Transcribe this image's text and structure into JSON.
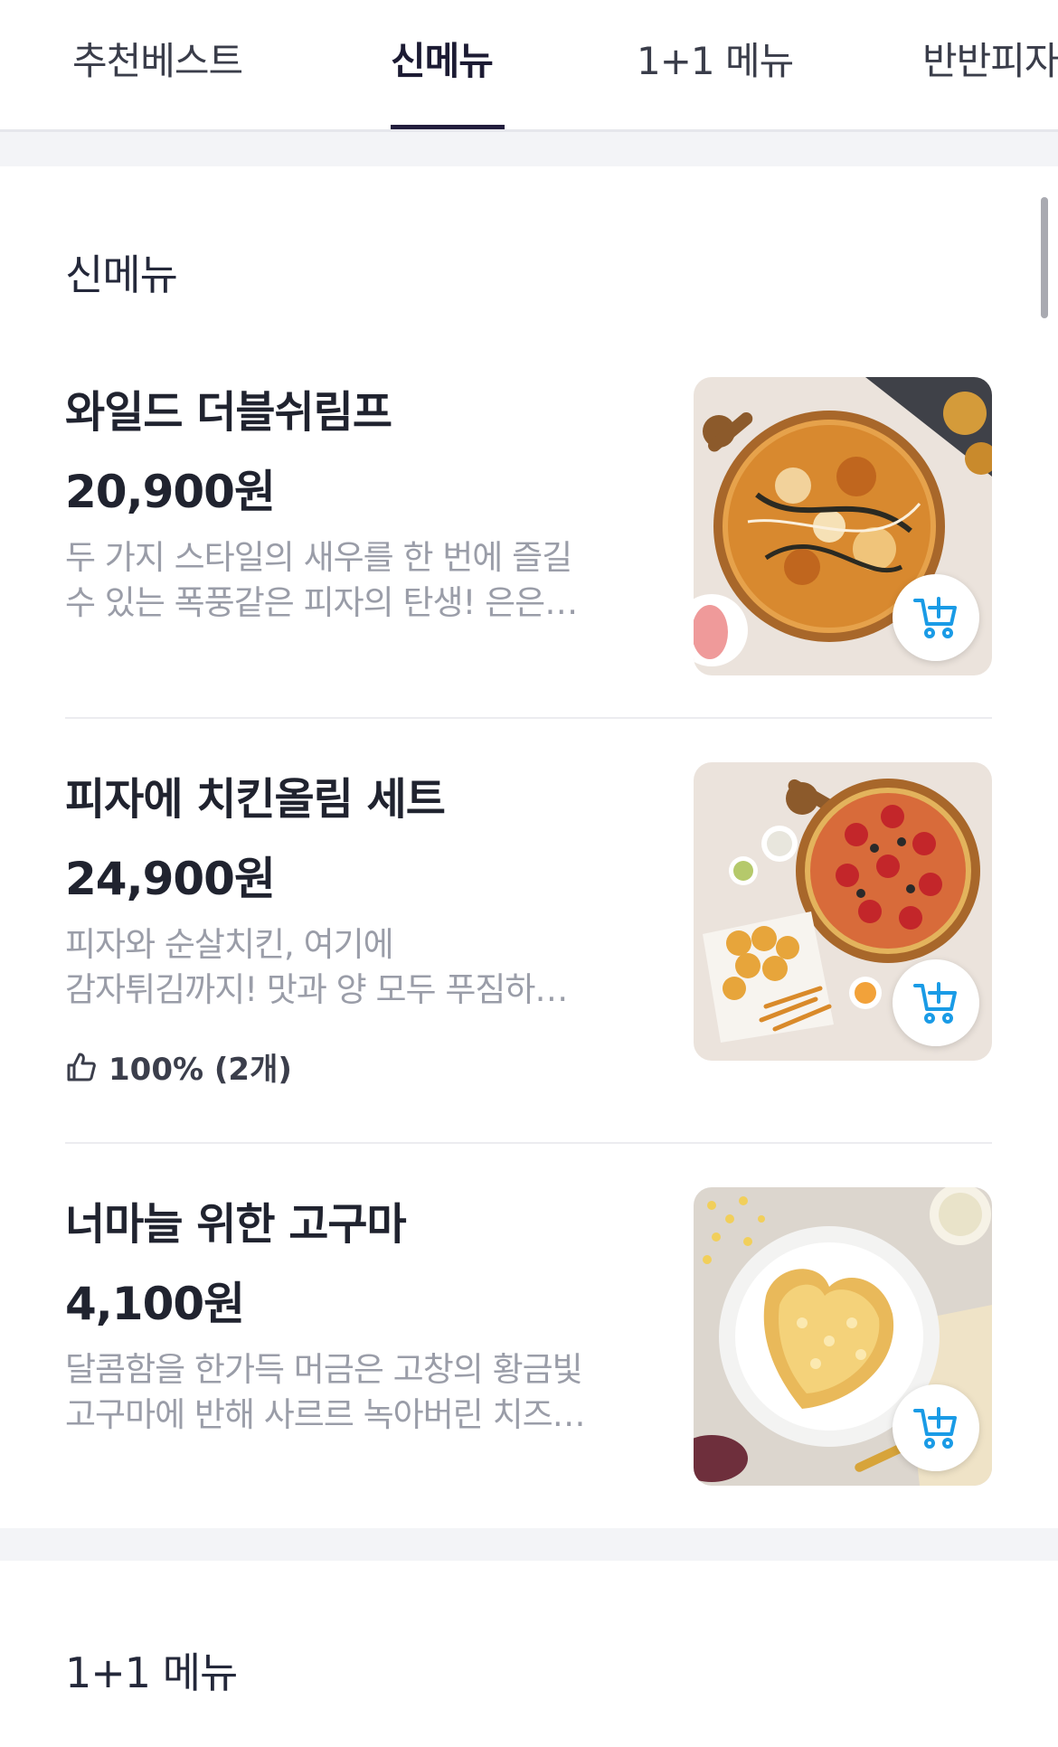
{
  "tabs": [
    {
      "label": "추천베스트",
      "active": false
    },
    {
      "label": "신메뉴",
      "active": true
    },
    {
      "label": "1+1 메뉴",
      "active": false
    },
    {
      "label": "반반피자",
      "active": false
    }
  ],
  "sections": [
    {
      "title": "신메뉴",
      "items": [
        {
          "name": "와일드 더블쉬림프",
          "price": "20,900원",
          "desc_line1": "두 가지 스타일의 새우를 한 번에 즐길",
          "desc_line2": "수 있는 폭풍같은 피자의 탄생! 은은…",
          "image": "pizza-shrimp-photo"
        },
        {
          "name": "피자에 치킨올림 세트",
          "price": "24,900원",
          "desc_line1": "피자와 순살치킨, 여기에",
          "desc_line2": "감자튀김까지! 맛과 양 모두 푸짐하…",
          "rating": "100% (2개)",
          "image": "pizza-chicken-set-photo"
        },
        {
          "name": "너마늘 위한 고구마",
          "price": "4,100원",
          "desc_line1": "달콤함을 한가득 머금은 고창의 황금빛",
          "desc_line2": "고구마에 반해 사르르 녹아버린 치즈…",
          "image": "sweet-potato-photo"
        }
      ]
    },
    {
      "title": "1+1 메뉴"
    }
  ],
  "icons": {
    "cart": "cart-add-icon",
    "thumbs_up": "thumbs-up-icon"
  },
  "colors": {
    "accent_cart": "#1a9be6",
    "tab_active": "#221d3d",
    "muted_text": "#9a9da8"
  }
}
